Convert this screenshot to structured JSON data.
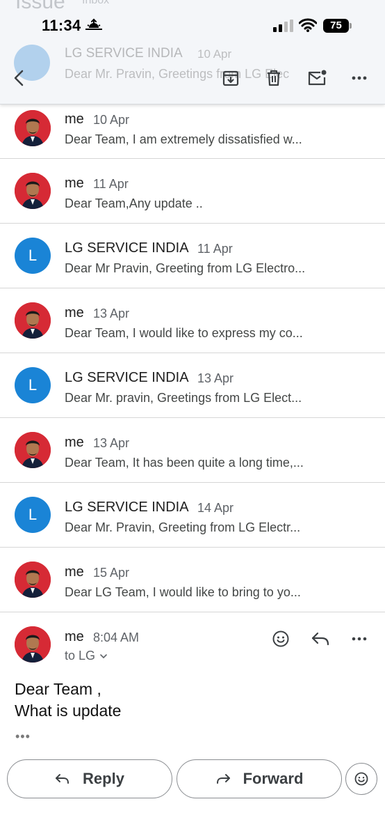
{
  "status_bar": {
    "time": "11:34",
    "battery": "75"
  },
  "background_header": {
    "subject": "Issue",
    "label": "Inbox",
    "sender": "LG SERVICE INDIA",
    "date": "10 Apr",
    "snippet": "Dear Mr. Pravin, Greetings from LG Elec"
  },
  "toolbar": {
    "back_icon": "back-arrow-icon",
    "archive_icon": "archive-icon",
    "delete_icon": "trash-icon",
    "mark_unread_icon": "mark-unread-icon",
    "more_icon": "more-horizontal-icon"
  },
  "messages": [
    {
      "sender": "me",
      "date": "10 Apr",
      "snippet": "Dear Team, I am extremely dissatisfied w...",
      "avatar": "photo"
    },
    {
      "sender": "me",
      "date": "11 Apr",
      "snippet": "Dear Team,Any update ..",
      "avatar": "photo"
    },
    {
      "sender": "LG SERVICE INDIA",
      "date": "11 Apr",
      "snippet": "Dear Mr Pravin, Greeting from LG Electro...",
      "avatar": "L"
    },
    {
      "sender": "me",
      "date": "13 Apr",
      "snippet": "Dear Team, I would like to express my co...",
      "avatar": "photo"
    },
    {
      "sender": "LG SERVICE INDIA",
      "date": "13 Apr",
      "snippet": "Dear Mr. pravin, Greetings from LG Elect...",
      "avatar": "L"
    },
    {
      "sender": "me",
      "date": "13 Apr",
      "snippet": "Dear Team, It has been quite a long time,...",
      "avatar": "photo"
    },
    {
      "sender": "LG SERVICE INDIA",
      "date": "14 Apr",
      "snippet": "Dear Mr. Pravin, Greeting from LG Electr...",
      "avatar": "L"
    },
    {
      "sender": "me",
      "date": "15 Apr",
      "snippet": "Dear LG Team, I would like to bring to yo...",
      "avatar": "photo"
    }
  ],
  "expanded_message": {
    "sender": "me",
    "time": "8:04 AM",
    "to": "to LG",
    "body_line1": "Dear Team ,",
    "body_line2": "What is update",
    "trimmed": "•••"
  },
  "actions": {
    "reply_label": "Reply",
    "forward_label": "Forward"
  },
  "colors": {
    "avatar_lg": "#1a84d6",
    "avatar_photo_bg": "#d62a35",
    "header_bg": "#f4f6f9"
  }
}
